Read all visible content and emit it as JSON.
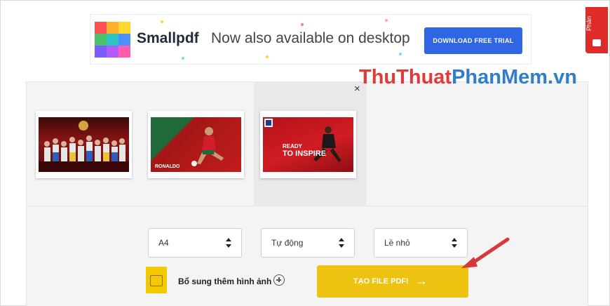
{
  "ad": {
    "brand": "Smallpdf",
    "tagline": "Now also available on desktop",
    "button_label": "DOWNLOAD FREE TRIAL",
    "logo_colors": [
      "#ff4f4f",
      "#ffae2e",
      "#ffd62e",
      "#4ac16a",
      "#2ec4c4",
      "#4a90ff",
      "#7b5cff",
      "#b05cff",
      "#ff5cb0"
    ],
    "button_color": "#2e66e6"
  },
  "side_tab": {
    "label": "Phản",
    "icon": "gift-icon",
    "color": "#e02b2b"
  },
  "watermark": {
    "part1": "ThuThuat",
    "part2": "PhanMem.vn"
  },
  "close_symbol": "×",
  "thumbnails": [
    {
      "name": "world-cup-team-poster"
    },
    {
      "name": "ronaldo-poster",
      "caption": "RONALDO"
    },
    {
      "name": "ready-to-inspire-poster",
      "caption": "READY TO INSPIRE"
    }
  ],
  "options": {
    "page_size": "A4",
    "orientation": "Tự động",
    "margin": "Lề nhỏ",
    "add_images_label": "Bổ sung thêm hình ảnh",
    "create_button_label": "TẠO FILE PDF!",
    "create_button_color": "#eec211"
  }
}
